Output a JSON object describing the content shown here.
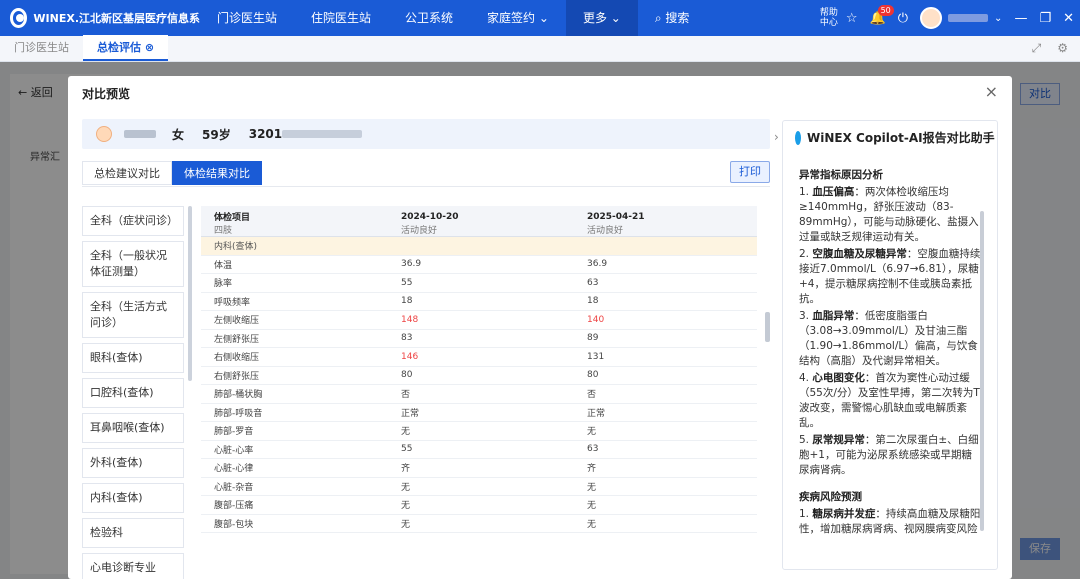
{
  "topnav": {
    "brand": "WINEX.江北新区基层医疗信息系",
    "items": [
      "门诊医生站",
      "住院医生站",
      "公卫系统",
      "家庭签约",
      "更多",
      "搜索"
    ],
    "help": "帮助中心",
    "notification_count": "50"
  },
  "tabs": [
    {
      "label": "门诊医生站"
    },
    {
      "label": "总检评估"
    }
  ],
  "background": {
    "back_label": "返回",
    "compare_label": "对比",
    "save_label": "保存",
    "abnormal_label": "异常汇"
  },
  "modal": {
    "title": "对比预览",
    "patient": {
      "gender": "女",
      "age": "59岁",
      "id_prefix": "3201"
    },
    "sub_tabs": [
      "总检建议对比",
      "体检结果对比"
    ],
    "print_label": "打印",
    "categories": [
      "全科（症状问诊）",
      "全科（一般状况体征测量）",
      "全科（生活方式问诊）",
      "眼科(查体)",
      "口腔科(查体)",
      "耳鼻咽喉(查体)",
      "外科(查体)",
      "内科(查体)",
      "检验科",
      "心电诊断专业"
    ],
    "table": {
      "headers": [
        "体检项目",
        "2024-10-20",
        "2025-04-21"
      ],
      "header_sub": [
        "四肢",
        "活动良好",
        "活动良好"
      ],
      "section": "内科(查体)",
      "rows": [
        {
          "item": "体温",
          "v1": "36.9",
          "v2": "36.9",
          "r1": false,
          "r2": false
        },
        {
          "item": "脉率",
          "v1": "55",
          "v2": "63",
          "r1": false,
          "r2": false
        },
        {
          "item": "呼吸频率",
          "v1": "18",
          "v2": "18",
          "r1": false,
          "r2": false
        },
        {
          "item": "左侧收缩压",
          "v1": "148",
          "v2": "140",
          "r1": true,
          "r2": true
        },
        {
          "item": "左侧舒张压",
          "v1": "83",
          "v2": "89",
          "r1": false,
          "r2": false
        },
        {
          "item": "右侧收缩压",
          "v1": "146",
          "v2": "131",
          "r1": true,
          "r2": false
        },
        {
          "item": "右侧舒张压",
          "v1": "80",
          "v2": "80",
          "r1": false,
          "r2": false
        },
        {
          "item": "肺部-桶状胸",
          "v1": "否",
          "v2": "否",
          "r1": false,
          "r2": false
        },
        {
          "item": "肺部-呼吸音",
          "v1": "正常",
          "v2": "正常",
          "r1": false,
          "r2": false
        },
        {
          "item": "肺部-罗音",
          "v1": "无",
          "v2": "无",
          "r1": false,
          "r2": false
        },
        {
          "item": "心脏-心率",
          "v1": "55",
          "v2": "63",
          "r1": false,
          "r2": false
        },
        {
          "item": "心脏-心律",
          "v1": "齐",
          "v2": "齐",
          "r1": false,
          "r2": false
        },
        {
          "item": "心脏-杂音",
          "v1": "无",
          "v2": "无",
          "r1": false,
          "r2": false
        },
        {
          "item": "腹部-压痛",
          "v1": "无",
          "v2": "无",
          "r1": false,
          "r2": false
        },
        {
          "item": "腹部-包块",
          "v1": "无",
          "v2": "无",
          "r1": false,
          "r2": false
        }
      ]
    },
    "ai": {
      "title": "WiNEX Copilot-AI报告对比助手",
      "section1": "异常指标原因分析",
      "items1": [
        {
          "n": "1. ",
          "k": "血压偏高",
          "t": "：两次体检收缩压均≥140mmHg，舒张压波动（83-89mmHg），可能与动脉硬化、盐摄入过量或缺乏规律运动有关。"
        },
        {
          "n": "2. ",
          "k": "空腹血糖及尿糖异常",
          "t": "：空腹血糖持续接近7.0mmol/L（6.97→6.81），尿糖+4，提示糖尿病控制不佳或胰岛素抵抗。"
        },
        {
          "n": "3. ",
          "k": "血脂异常",
          "t": "：低密度脂蛋白（3.08→3.09mmol/L）及甘油三酯（1.90→1.86mmol/L）偏高，与饮食结构（高脂）及代谢异常相关。"
        },
        {
          "n": "4. ",
          "k": "心电图变化",
          "t": "：首次为窦性心动过缓（55次/分）及室性早搏，第二次转为T波改变，需警惕心肌缺血或电解质紊乱。"
        },
        {
          "n": "5. ",
          "k": "尿常规异常",
          "t": "：第二次尿蛋白±、白细胞+1，可能为泌尿系统感染或早期糖尿病肾病。"
        }
      ],
      "section2": "疾病风险预测",
      "items2": [
        {
          "n": "1. ",
          "k": "糖尿病并发症",
          "t": "：持续高血糖及尿糖阳性，增加糖尿病肾病、视网膜病变风险"
        }
      ]
    }
  }
}
